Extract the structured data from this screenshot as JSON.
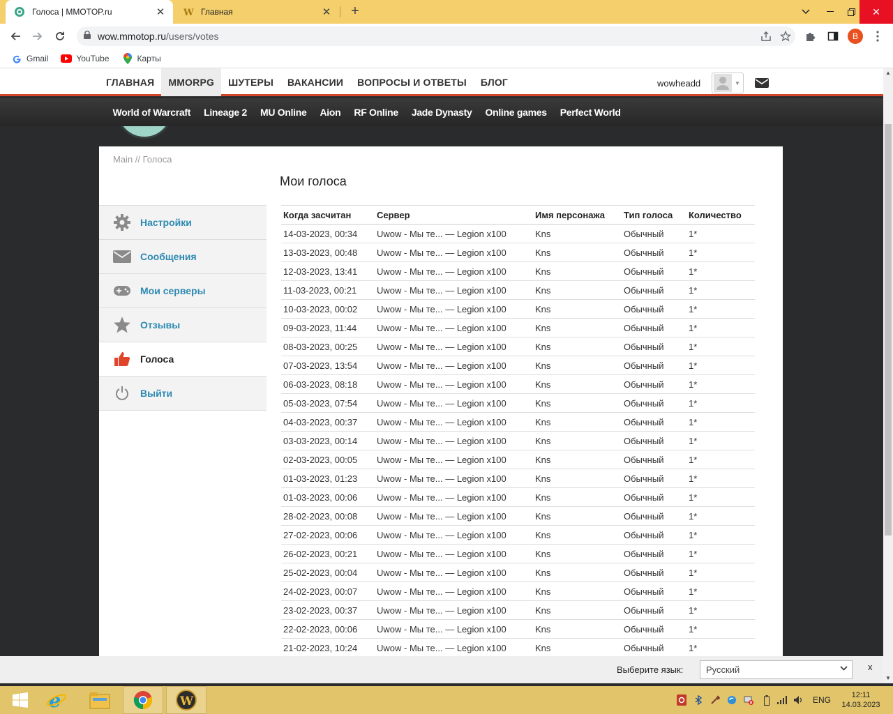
{
  "browser": {
    "tabs": [
      {
        "title": "Голоса | MMOTOP.ru",
        "active": true
      },
      {
        "title": "Главная",
        "active": false
      }
    ],
    "url_host": "wow.mmotop.ru",
    "url_path": "/users/votes",
    "profile_initial": "B",
    "bookmarks": [
      "Gmail",
      "YouTube",
      "Карты"
    ]
  },
  "site": {
    "nav": [
      "ГЛАВНАЯ",
      "MMORPG",
      "ШУТЕРЫ",
      "ВАКАНСИИ",
      "ВОПРОСЫ И ОТВЕТЫ",
      "БЛОГ"
    ],
    "nav_active": "MMORPG",
    "username": "wowheadd",
    "games": [
      "World of Warcraft",
      "Lineage 2",
      "MU Online",
      "Aion",
      "RF Online",
      "Jade Dynasty",
      "Online games",
      "Perfect World"
    ],
    "accent_color": "#d5452c",
    "link_color": "#2e8ab3"
  },
  "breadcrumb": "Main // Голоса",
  "sidebar": {
    "items": [
      {
        "label": "Настройки",
        "icon": "gear-icon"
      },
      {
        "label": "Сообщения",
        "icon": "envelope-icon"
      },
      {
        "label": "Мои серверы",
        "icon": "gamepad-icon"
      },
      {
        "label": "Отзывы",
        "icon": "star-icon"
      },
      {
        "label": "Голоса",
        "icon": "thumbs-up-icon",
        "active": true
      },
      {
        "label": "Выйти",
        "icon": "power-icon"
      }
    ]
  },
  "page_title": "Мои голоса",
  "table": {
    "headers": [
      "Когда засчитан",
      "Сервер",
      "Имя персонажа",
      "Тип голоса",
      "Количество"
    ],
    "rows": [
      [
        "14-03-2023, 00:34",
        "Uwow - Мы те... — Legion x100",
        "Kns",
        "Обычный",
        "1*"
      ],
      [
        "13-03-2023, 00:48",
        "Uwow - Мы те... — Legion x100",
        "Kns",
        "Обычный",
        "1*"
      ],
      [
        "12-03-2023, 13:41",
        "Uwow - Мы те... — Legion x100",
        "Kns",
        "Обычный",
        "1*"
      ],
      [
        "11-03-2023, 00:21",
        "Uwow - Мы те... — Legion x100",
        "Kns",
        "Обычный",
        "1*"
      ],
      [
        "10-03-2023, 00:02",
        "Uwow - Мы те... — Legion x100",
        "Kns",
        "Обычный",
        "1*"
      ],
      [
        "09-03-2023, 11:44",
        "Uwow - Мы те... — Legion x100",
        "Kns",
        "Обычный",
        "1*"
      ],
      [
        "08-03-2023, 00:25",
        "Uwow - Мы те... — Legion x100",
        "Kns",
        "Обычный",
        "1*"
      ],
      [
        "07-03-2023, 13:54",
        "Uwow - Мы те... — Legion x100",
        "Kns",
        "Обычный",
        "1*"
      ],
      [
        "06-03-2023, 08:18",
        "Uwow - Мы те... — Legion x100",
        "Kns",
        "Обычный",
        "1*"
      ],
      [
        "05-03-2023, 07:54",
        "Uwow - Мы те... — Legion x100",
        "Kns",
        "Обычный",
        "1*"
      ],
      [
        "04-03-2023, 00:37",
        "Uwow - Мы те... — Legion x100",
        "Kns",
        "Обычный",
        "1*"
      ],
      [
        "03-03-2023, 00:14",
        "Uwow - Мы те... — Legion x100",
        "Kns",
        "Обычный",
        "1*"
      ],
      [
        "02-03-2023, 00:05",
        "Uwow - Мы те... — Legion x100",
        "Kns",
        "Обычный",
        "1*"
      ],
      [
        "01-03-2023, 01:23",
        "Uwow - Мы те... — Legion x100",
        "Kns",
        "Обычный",
        "1*"
      ],
      [
        "01-03-2023, 00:06",
        "Uwow - Мы те... — Legion x100",
        "Kns",
        "Обычный",
        "1*"
      ],
      [
        "28-02-2023, 00:08",
        "Uwow - Мы те... — Legion x100",
        "Kns",
        "Обычный",
        "1*"
      ],
      [
        "27-02-2023, 00:06",
        "Uwow - Мы те... — Legion x100",
        "Kns",
        "Обычный",
        "1*"
      ],
      [
        "26-02-2023, 00:21",
        "Uwow - Мы те... — Legion x100",
        "Kns",
        "Обычный",
        "1*"
      ],
      [
        "25-02-2023, 00:04",
        "Uwow - Мы те... — Legion x100",
        "Kns",
        "Обычный",
        "1*"
      ],
      [
        "24-02-2023, 00:07",
        "Uwow - Мы те... — Legion x100",
        "Kns",
        "Обычный",
        "1*"
      ],
      [
        "23-02-2023, 00:37",
        "Uwow - Мы те... — Legion x100",
        "Kns",
        "Обычный",
        "1*"
      ],
      [
        "22-02-2023, 00:06",
        "Uwow - Мы те... — Legion x100",
        "Kns",
        "Обычный",
        "1*"
      ],
      [
        "21-02-2023, 10:24",
        "Uwow - Мы те... — Legion x100",
        "Kns",
        "Обычный",
        "1*"
      ]
    ]
  },
  "language_bar": {
    "label": "Выберите язык:",
    "selected": "Русский",
    "close": "x"
  },
  "taskbar": {
    "lang": "ENG",
    "time": "12:11",
    "date": "14.03.2023",
    "apps": [
      "windows-logo-icon",
      "internet-explorer-icon",
      "file-explorer-icon",
      "chrome-icon",
      "world-of-warcraft-icon"
    ]
  }
}
